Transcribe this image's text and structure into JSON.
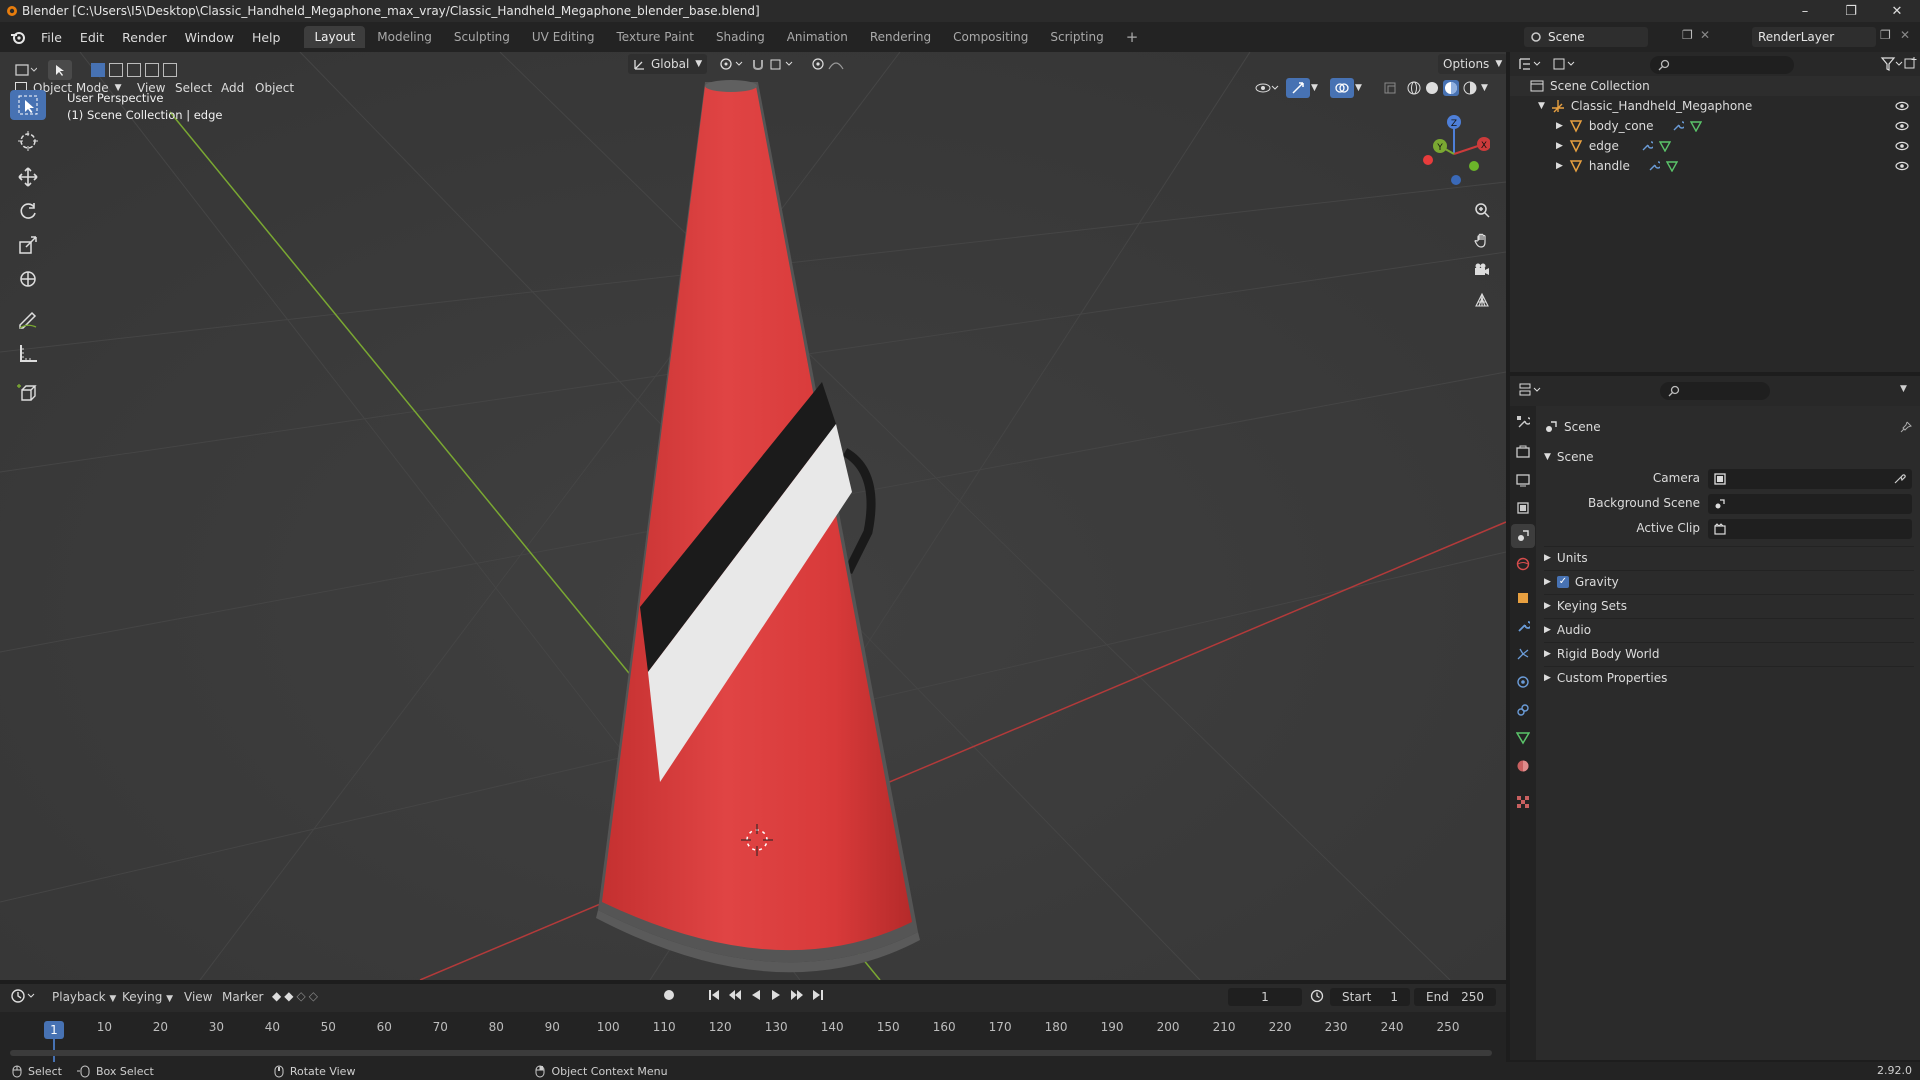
{
  "window": {
    "title": "Blender [C:\\Users\\I5\\Desktop\\Classic_Handheld_Megaphone_max_vray/Classic_Handheld_Megaphone_blender_base.blend]"
  },
  "menu": [
    "File",
    "Edit",
    "Render",
    "Window",
    "Help"
  ],
  "workspaces": [
    "Layout",
    "Modeling",
    "Sculpting",
    "UV Editing",
    "Texture Paint",
    "Shading",
    "Animation",
    "Rendering",
    "Compositing",
    "Scripting"
  ],
  "active_workspace": "Layout",
  "scene_field": "Scene",
  "renderlayer_field": "RenderLayer",
  "viewport": {
    "orientation": "Global",
    "options_label": "Options",
    "mode": "Object Mode",
    "menus": [
      "View",
      "Select",
      "Add",
      "Object"
    ],
    "overlay_title": "User Perspective",
    "overlay_sub": "(1) Scene Collection | edge",
    "gizmo_labels": {
      "x": "X",
      "y": "Y",
      "z": "Z"
    }
  },
  "outliner": {
    "root": "Scene Collection",
    "collection": "Classic_Handheld_Megaphone",
    "objects": [
      "body_cone",
      "edge",
      "handle"
    ]
  },
  "properties": {
    "context_title": "Scene",
    "panel_title": "Scene",
    "fields": {
      "camera": "Camera",
      "background_scene": "Background Scene",
      "active_clip": "Active Clip"
    },
    "subpanels": [
      "Units",
      "Gravity",
      "Keying Sets",
      "Audio",
      "Rigid Body World",
      "Custom Properties"
    ],
    "gravity_checked": true
  },
  "timeline": {
    "menus": [
      "Playback",
      "Keying",
      "View",
      "Marker"
    ],
    "current_frame": "1",
    "start_label": "Start",
    "start_value": "1",
    "end_label": "End",
    "end_value": "250",
    "ticks": [
      "1",
      "10",
      "20",
      "30",
      "40",
      "50",
      "60",
      "70",
      "80",
      "90",
      "100",
      "110",
      "120",
      "130",
      "140",
      "150",
      "160",
      "170",
      "180",
      "190",
      "200",
      "210",
      "220",
      "230",
      "240",
      "250"
    ]
  },
  "statusbar": {
    "select": "Select",
    "box_select": "Box Select",
    "rotate_view": "Rotate View",
    "context_menu": "Object Context Menu",
    "version": "2.92.0"
  },
  "colors": {
    "accent": "#4772b3",
    "cone_red": "#d93a3a",
    "axis_x": "#b33a3a",
    "axis_y": "#7aa832"
  }
}
